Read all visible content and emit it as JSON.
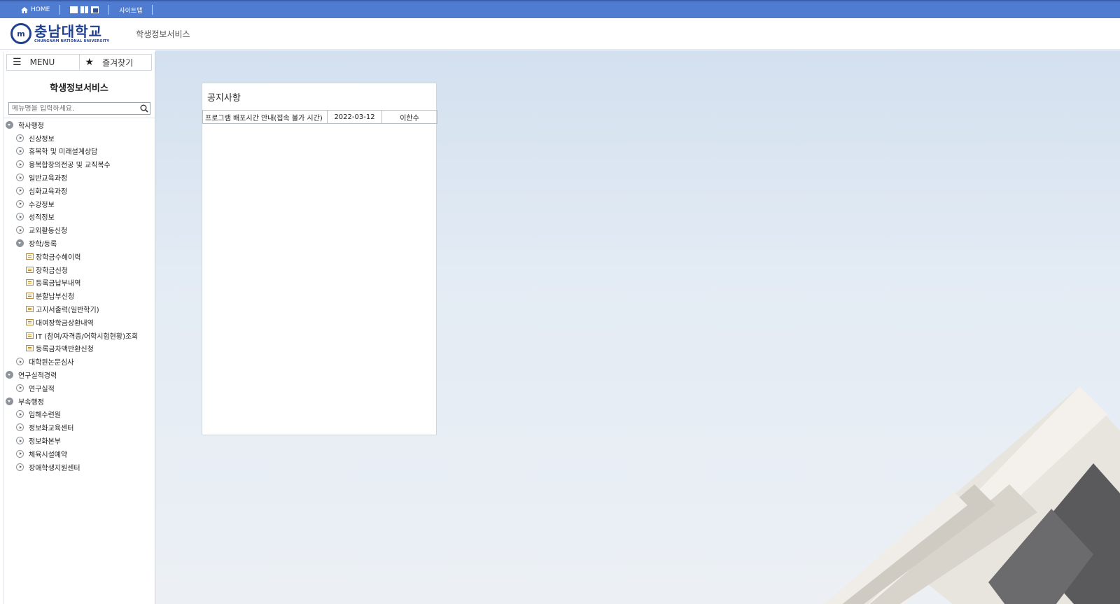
{
  "topbar": {
    "home_label": "HOME",
    "sitemap_label": "사이트맵"
  },
  "header": {
    "logo_korean": "충남대학교",
    "logo_english": "CHUNGNAM NATIONAL UNIVERSITY",
    "service_name": "학생정보서비스"
  },
  "sidebar": {
    "menu_tab": "MENU",
    "favorites_tab": "즐겨찾기",
    "title": "학생정보서비스",
    "search_placeholder": "메뉴명을 입력하세요.",
    "tree": [
      {
        "label": "학사행정",
        "level": 1,
        "icon": "expanded"
      },
      {
        "label": "신상정보",
        "level": 2,
        "icon": "collapsed"
      },
      {
        "label": "휴복학 및 미래설계상담",
        "level": 2,
        "icon": "collapsed"
      },
      {
        "label": "융복합창의전공 및 교직복수",
        "level": 2,
        "icon": "collapsed"
      },
      {
        "label": "일반교육과정",
        "level": 2,
        "icon": "collapsed"
      },
      {
        "label": "심화교육과정",
        "level": 2,
        "icon": "collapsed"
      },
      {
        "label": "수강정보",
        "level": 2,
        "icon": "collapsed"
      },
      {
        "label": "성적정보",
        "level": 2,
        "icon": "collapsed"
      },
      {
        "label": "교외활동신청",
        "level": 2,
        "icon": "collapsed"
      },
      {
        "label": "장학/등록",
        "level": 2,
        "icon": "expanded"
      },
      {
        "label": "장학금수혜이력",
        "level": 3,
        "icon": "page"
      },
      {
        "label": "장학금신청",
        "level": 3,
        "icon": "page"
      },
      {
        "label": "등록금납부내역",
        "level": 3,
        "icon": "page"
      },
      {
        "label": "분할납부신청",
        "level": 3,
        "icon": "page"
      },
      {
        "label": "고지서출력(일반학기)",
        "level": 3,
        "icon": "page"
      },
      {
        "label": "대여장학금상환내역",
        "level": 3,
        "icon": "page"
      },
      {
        "label": "IT (참여/자격증/어학시험현황)조회",
        "level": 3,
        "icon": "page"
      },
      {
        "label": "등록금차액반환신청",
        "level": 3,
        "icon": "page"
      },
      {
        "label": "대학원논문심사",
        "level": 2,
        "icon": "collapsed"
      },
      {
        "label": "연구실적경력",
        "level": 1,
        "icon": "expanded"
      },
      {
        "label": "연구실적",
        "level": 2,
        "icon": "collapsed"
      },
      {
        "label": "부속행정",
        "level": 1,
        "icon": "expanded"
      },
      {
        "label": "임해수련원",
        "level": 2,
        "icon": "collapsed"
      },
      {
        "label": "정보화교육센터",
        "level": 2,
        "icon": "collapsed"
      },
      {
        "label": "정보화본부",
        "level": 2,
        "icon": "collapsed"
      },
      {
        "label": "체육시설예약",
        "level": 2,
        "icon": "collapsed"
      },
      {
        "label": "장애학생지원센터",
        "level": 2,
        "icon": "collapsed"
      }
    ]
  },
  "notice": {
    "title": "공지사항",
    "rows": [
      {
        "subject": "프로그램 배포시간 안내(접속 불가 시간)",
        "date": "2022-03-12",
        "author": "이한수"
      }
    ]
  },
  "colors": {
    "topbar": "#4f7bd0",
    "brand": "#1f3f8f"
  }
}
